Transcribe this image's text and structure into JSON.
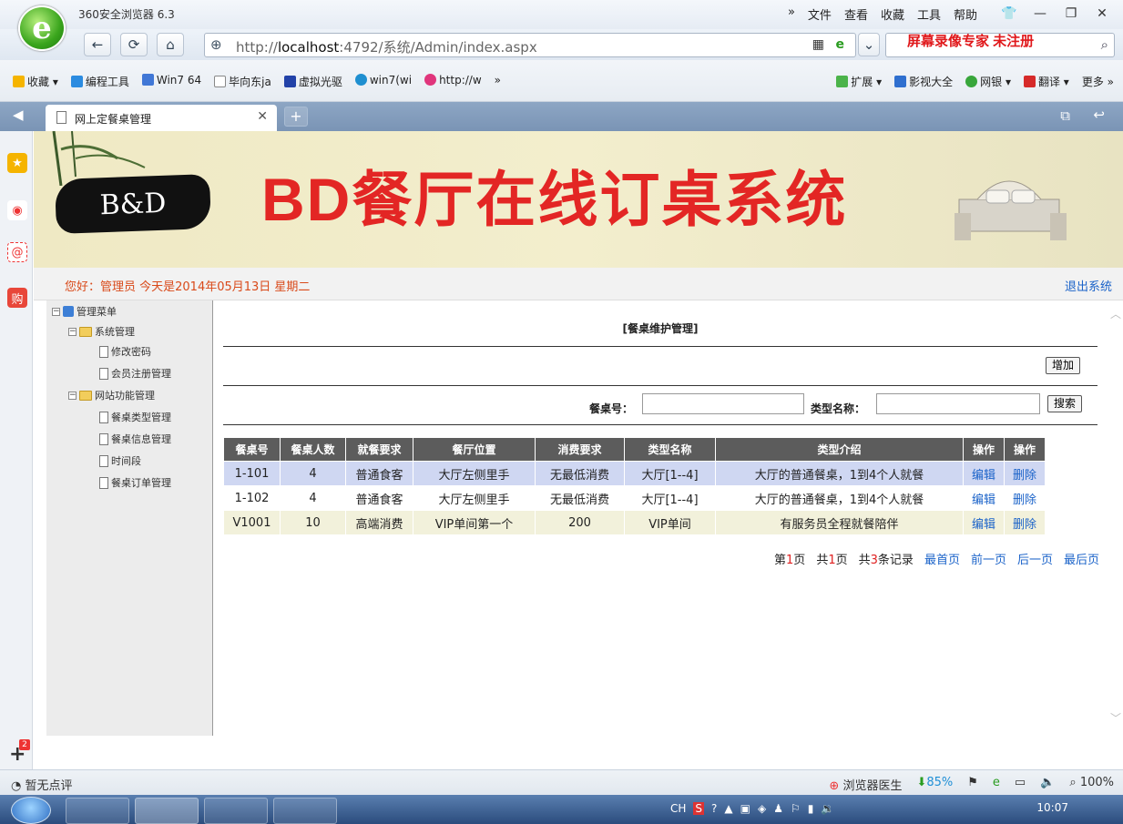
{
  "browser": {
    "title": "360安全浏览器 6.3",
    "menu": [
      "»",
      "文件",
      "查看",
      "收藏",
      "工具",
      "帮助"
    ],
    "url_prefix": "http://",
    "url_host": "localhost",
    "url_rest": ":4792/系统/Admin/index.aspx",
    "watermark": "屏幕录像专家 未注册",
    "bookmarks": [
      "收藏 ▾",
      "编程工具",
      "Win7 64",
      "毕向东ja",
      "虚拟光驱",
      "win7(wi",
      "http://w",
      "»"
    ],
    "bookmarks_right": [
      "扩展 ▾",
      "影视大全",
      "网银 ▾",
      "翻译 ▾",
      "更多 »"
    ],
    "tab_title": "网上定餐桌管理",
    "sidebar_badge": "2",
    "status_left": "暂无点评",
    "status_items": [
      "浏览器医生",
      "85%",
      "100%"
    ],
    "clock": "10:07",
    "tray_lang": "CH"
  },
  "site": {
    "logo_text": "B&D",
    "banner_title": "BD餐厅在线订桌系统",
    "greeting": "您好：管理员 今天是2014年05月13日 星期二",
    "logout": "退出系统"
  },
  "tree": {
    "root": "管理菜单",
    "groups": [
      {
        "label": "系统管理",
        "items": [
          "修改密码",
          "会员注册管理"
        ]
      },
      {
        "label": "网站功能管理",
        "items": [
          "餐桌类型管理",
          "餐桌信息管理",
          "时间段",
          "餐桌订单管理"
        ]
      }
    ]
  },
  "main": {
    "title": "[餐桌维护管理]",
    "add_button": "增加",
    "search": {
      "table_no_label": "餐桌号：",
      "type_name_label": "类型名称：",
      "search_button": "搜索",
      "table_no_value": "",
      "type_name_value": ""
    },
    "table": {
      "headers": [
        "餐桌号",
        "餐桌人数",
        "就餐要求",
        "餐厅位置",
        "消费要求",
        "类型名称",
        "类型介绍",
        "操作",
        "操作"
      ],
      "rows": [
        [
          "1-101",
          "4",
          "普通食客",
          "大厅左侧里手",
          "无最低消费",
          "大厅[1--4]",
          "大厅的普通餐桌，1到4个人就餐",
          "编辑",
          "删除"
        ],
        [
          "1-102",
          "4",
          "普通食客",
          "大厅左侧里手",
          "无最低消费",
          "大厅[1--4]",
          "大厅的普通餐桌，1到4个人就餐",
          "编辑",
          "删除"
        ],
        [
          "V1001",
          "10",
          "高端消费",
          "VIP单间第一个",
          "200",
          "VIP单间",
          "有服务员全程就餐陪伴",
          "编辑",
          "删除"
        ]
      ]
    },
    "pager": {
      "page_prefix": "第",
      "page_num": "1",
      "page_suffix": "页",
      "total_prefix": "共",
      "total_pages": "1",
      "total_suffix": "页",
      "records_prefix": "共",
      "records": "3",
      "records_suffix": "条记录",
      "first": "最首页",
      "prev": "前一页",
      "next": "后一页",
      "last": "最后页"
    }
  },
  "colors": {
    "banner_red": "#e32624",
    "link_blue": "#1b63c9",
    "header_gray": "#5c5c5c",
    "row_highlight": "#cfd7f2",
    "row_vip": "#f2f1db"
  }
}
